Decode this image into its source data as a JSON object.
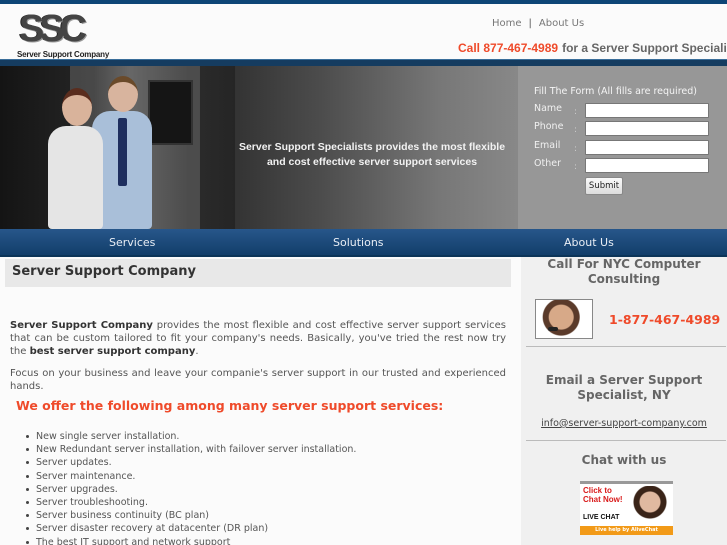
{
  "brand": {
    "logo_mark": "SSC",
    "logo_subtitle": "Server Support Company",
    "colors": {
      "navy": "#0d4576",
      "accent_orange": "#ef4a2a",
      "form_panel_gray": "#979797"
    }
  },
  "header": {
    "nav": [
      {
        "label": "Home"
      },
      {
        "label": "About Us"
      }
    ],
    "separator": "|",
    "call_phone": "Call 877-467-4989",
    "call_rest": "for a Server Support Specialist"
  },
  "hero": {
    "tagline": "Server Support Specialists provides the most flexible and cost effective server support services"
  },
  "form": {
    "title": "Fill The Form (All fills are required)",
    "fields": [
      {
        "label": "Name",
        "value": "",
        "placeholder": ""
      },
      {
        "label": "Phone",
        "value": "",
        "placeholder": ""
      },
      {
        "label": "Email",
        "value": "",
        "placeholder": ""
      },
      {
        "label": "Other",
        "value": "",
        "placeholder": ""
      }
    ],
    "colon": ":",
    "submit_label": "Submit"
  },
  "main_nav": [
    {
      "label": "Services"
    },
    {
      "label": "Solutions"
    },
    {
      "label": "About Us"
    }
  ],
  "content": {
    "heading": "Server Support Company",
    "intro_bold": "Server Support Company",
    "intro_text": " provides the most flexible and cost effective server support services that can be custom tailored to fit your company's needs. Basically, you've tried the rest now try the ",
    "intro_bold_end": "best server support company",
    "intro_end": ".",
    "focus_text": "Focus on your business and leave your companie's server support in our trusted and experienced hands.",
    "services_heading": "We offer the following among many server support services:",
    "services": [
      "New single server installation.",
      "New Redundant server installation, with failover server installation.",
      "Server updates.",
      "Server maintenance.",
      "Server upgrades.",
      "Server troubleshooting.",
      "Server business continuity (BC plan)",
      "Server disaster recovery at datacenter (DR plan)",
      "The best IT support and network support"
    ]
  },
  "sidebar": {
    "call_heading": "Call For NYC Computer Consulting",
    "phone": "1-877-467-4989",
    "email_heading": "Email a Server Support Specialist, NY",
    "email": "info@server-support-company.com",
    "chat_heading": "Chat with us",
    "chat_banner": {
      "line1": "Click to Chat Now!",
      "line2": "LIVE CHAT",
      "footer": "Live help by AliveChat"
    }
  }
}
